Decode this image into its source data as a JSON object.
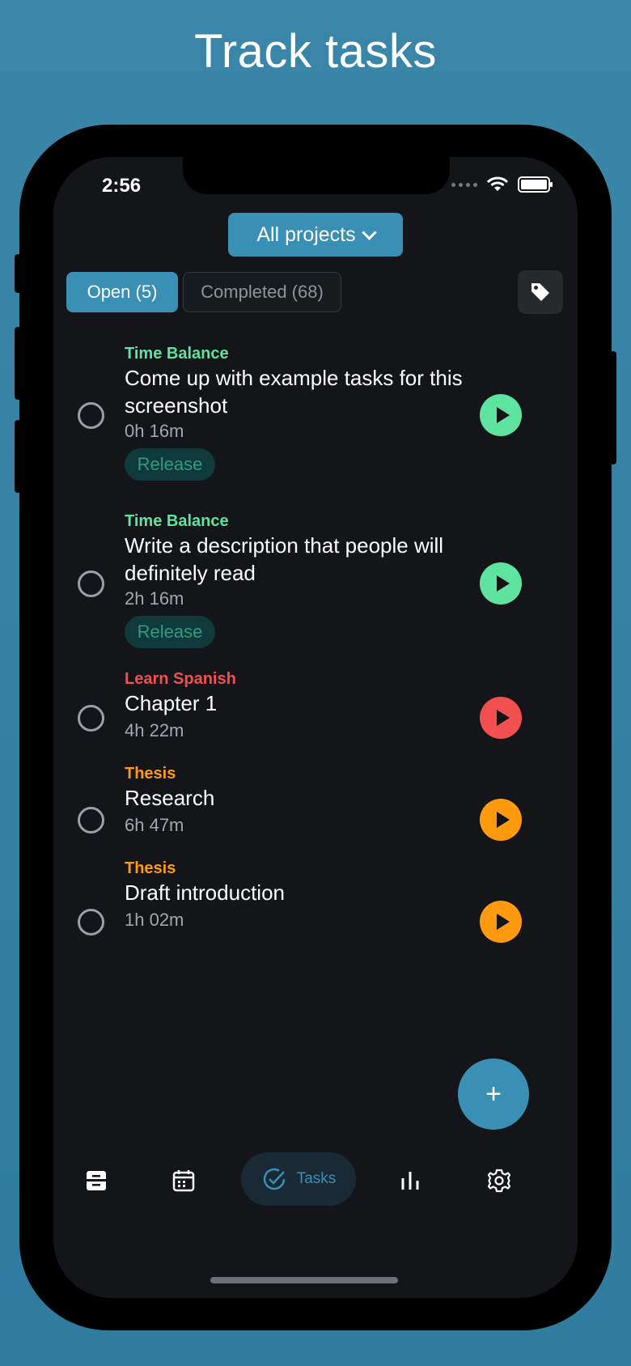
{
  "headline": "Track tasks",
  "status_bar": {
    "time": "2:56"
  },
  "header": {
    "project_selector": "All projects"
  },
  "tabs": {
    "open": "Open (5)",
    "completed": "Completed (68)"
  },
  "colors": {
    "accent": "#3a8fb5",
    "time_balance": "#5fe3a1",
    "learn_spanish": "#f24f4f",
    "thesis": "#ff9a0e",
    "release_chip_bg": "#0f3a39",
    "release_chip_text": "#2f9a8b"
  },
  "tasks": [
    {
      "project": "Time Balance",
      "title": "Come up with example tasks for this screenshot",
      "duration": "0h 16m",
      "label": "Release"
    },
    {
      "project": "Time Balance",
      "title": "Write a description that people will definitely read",
      "duration": "2h 16m",
      "label": "Release"
    },
    {
      "project": "Learn Spanish",
      "title": "Chapter 1",
      "duration": "4h 22m"
    },
    {
      "project": "Thesis",
      "title": "Research",
      "duration": "6h 47m"
    },
    {
      "project": "Thesis",
      "title": "Draft introduction",
      "duration": "1h 02m"
    }
  ],
  "fab": {
    "label": "+"
  },
  "bottom_nav": {
    "tasks_label": "Tasks"
  },
  "icons": [
    "inbox-icon",
    "calendar-icon",
    "check-circle-icon",
    "stats-icon",
    "gear-icon",
    "tag-icon",
    "play-icon",
    "plus-icon"
  ]
}
